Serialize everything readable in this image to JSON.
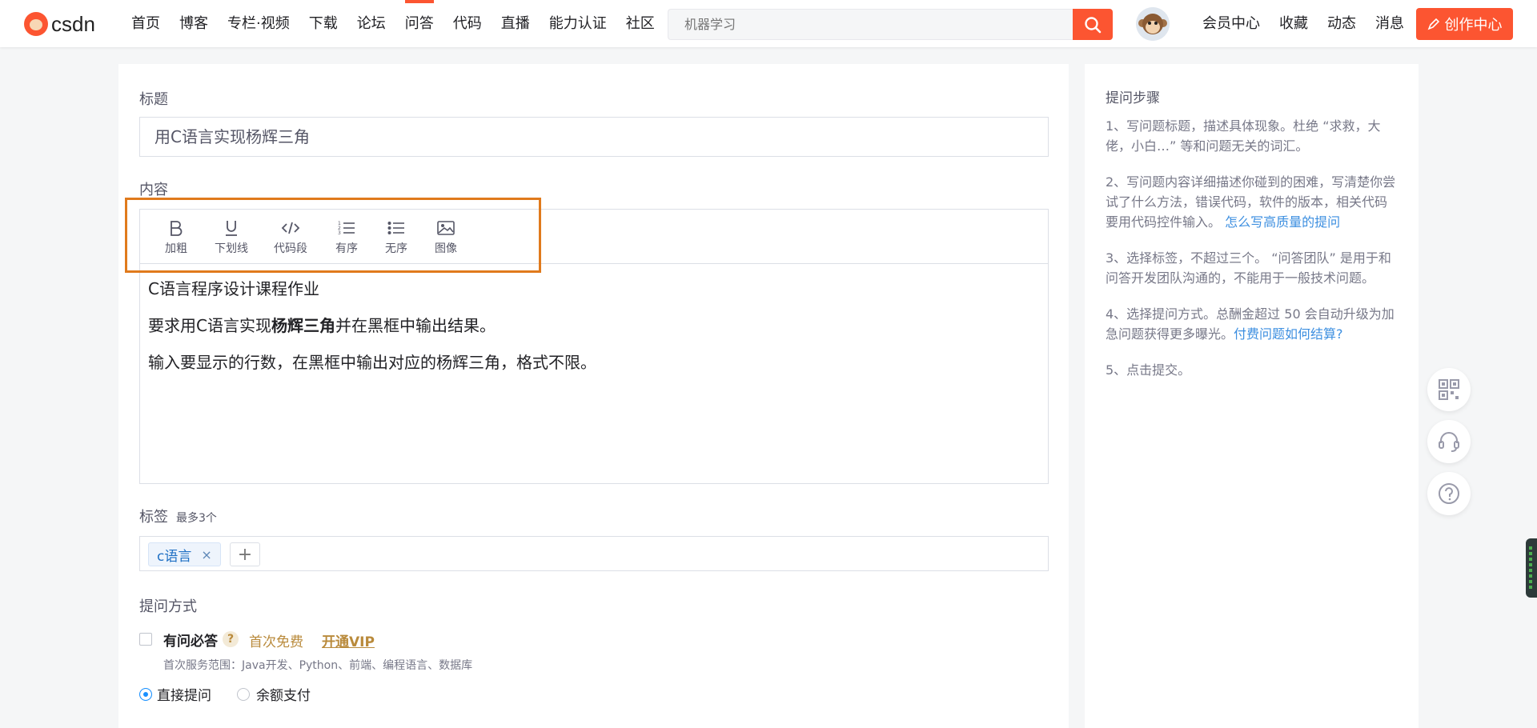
{
  "brand": {
    "name": "CSDN",
    "logo_text": "csdn",
    "accent": "#fc5531"
  },
  "nav": {
    "items": [
      "首页",
      "博客",
      "专栏·视频",
      "下载",
      "论坛",
      "问答",
      "代码",
      "直播",
      "能力认证",
      "社区"
    ],
    "active": "问答"
  },
  "search": {
    "placeholder": "机器学习"
  },
  "header_right": {
    "links": [
      "会员中心",
      "收藏",
      "动态",
      "消息"
    ],
    "create_label": "创作中心"
  },
  "form": {
    "title_label": "标题",
    "title_value": "用C语言实现杨辉三角",
    "content_label": "内容",
    "toolbar": [
      {
        "label": "加粗",
        "icon": "bold-icon"
      },
      {
        "label": "下划线",
        "icon": "underline-icon"
      },
      {
        "label": "代码段",
        "icon": "code-icon"
      },
      {
        "label": "有序",
        "icon": "ordered-list-icon"
      },
      {
        "label": "无序",
        "icon": "unordered-list-icon"
      },
      {
        "label": "图像",
        "icon": "image-icon"
      }
    ],
    "content": {
      "line1": "C语言程序设计课程作业",
      "line2_prefix": "要求用C语言实现",
      "line2_bold": "杨辉三角",
      "line2_suffix": "并在黑框中输出结果。",
      "line3": "输入要显示的行数，在黑框中输出对应的杨辉三角，格式不限。"
    },
    "tags_label": "标签",
    "tags_hint": "最多3个",
    "tags": [
      "c语言"
    ],
    "tag_remove": "×",
    "tag_add": "+",
    "ask_label": "提问方式",
    "ywbd": {
      "label": "有问必答",
      "help": "?",
      "free": "首次免费",
      "vip": "开通VIP",
      "scope": "首次服务范围：Java开发、Python、前端、编程语言、数据库",
      "checked": false
    },
    "modes": [
      {
        "label": "直接提问",
        "selected": true
      },
      {
        "label": "余额支付",
        "selected": false
      }
    ]
  },
  "help": {
    "title": "提问步骤",
    "step1": "1、写问题标题，描述具体现象。杜绝 “求救，大佬，小白…” 等和问题无关的词汇。",
    "step2_text": "2、写问题内容详细描述你碰到的困难，写清楚你尝试了什么方法，错误代码，软件的版本，相关代码要用代码控件输入。",
    "step2_link": "怎么写高质量的提问",
    "step3": "3、选择标签，不超过三个。 “问答团队” 是用于和问答开发团队沟通的，不能用于一般技术问题。",
    "step4_text": "4、选择提问方式。总酬金超过 50 会自动升级为加急问题获得更多曝光。",
    "step4_link": "付费问题如何结算?",
    "step5": "5、点击提交。"
  },
  "side_buttons": [
    "qrcode-icon",
    "headset-icon",
    "help-circle-icon"
  ]
}
